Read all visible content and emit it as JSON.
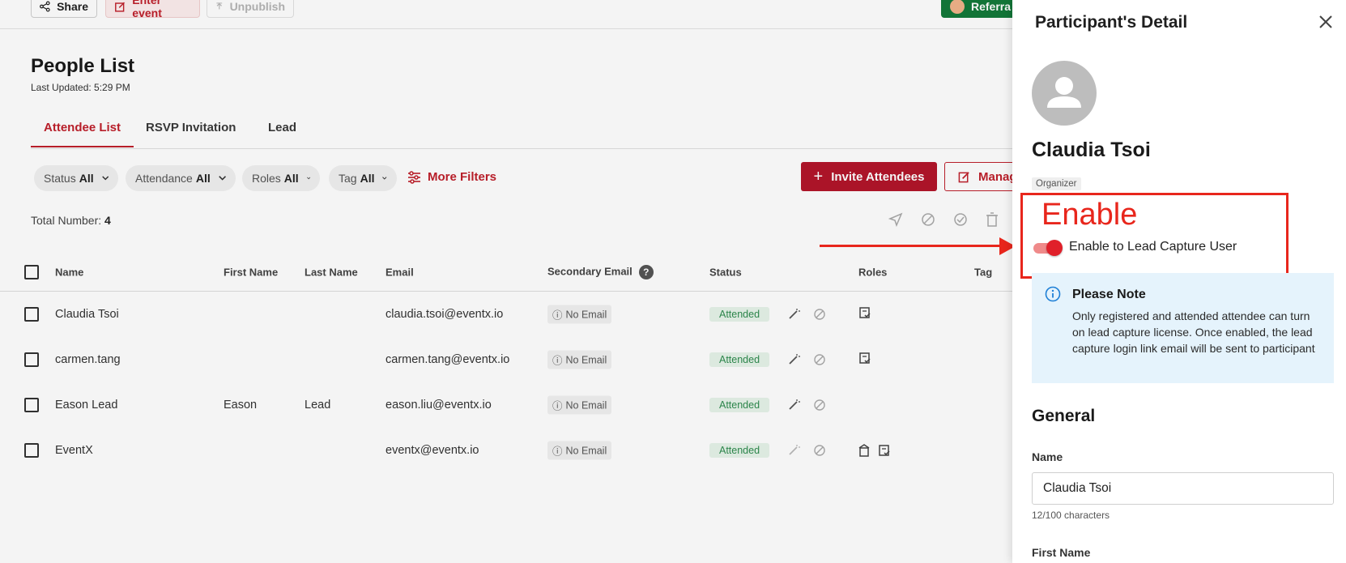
{
  "topbar": {
    "share_label": "Share",
    "enter_event_label": "Enter event",
    "unpublish_label": "Unpublish",
    "referral_label": "Referra"
  },
  "page": {
    "title": "People List",
    "last_updated": "Last Updated: 5:29 PM"
  },
  "tabs": [
    "Attendee List",
    "RSVP Invitation",
    "Lead"
  ],
  "filters": [
    {
      "label": "Status",
      "value": "All"
    },
    {
      "label": "Attendance",
      "value": "All"
    },
    {
      "label": "Roles",
      "value": "All"
    },
    {
      "label": "Tag",
      "value": "All"
    }
  ],
  "more_filters_label": "More Filters",
  "invite_label": "Invite Attendees",
  "manage_label": "Manag",
  "total": {
    "label": "Total Number:",
    "value": "4"
  },
  "table": {
    "headers": {
      "name": "Name",
      "first": "First Name",
      "last": "Last Name",
      "email": "Email",
      "secondary": "Secondary Email",
      "status": "Status",
      "roles": "Roles",
      "tag": "Tag"
    },
    "rows": [
      {
        "name": "Claudia Tsoi",
        "first": "",
        "last": "",
        "email": "claudia.tsoi@eventx.io",
        "secondary": "No Email",
        "status": "Attended"
      },
      {
        "name": "carmen.tang",
        "first": "",
        "last": "",
        "email": "carmen.tang@eventx.io",
        "secondary": "No Email",
        "status": "Attended"
      },
      {
        "name": "Eason Lead",
        "first": "Eason",
        "last": "Lead",
        "email": "eason.liu@eventx.io",
        "secondary": "No Email",
        "status": "Attended"
      },
      {
        "name": "EventX",
        "first": "",
        "last": "",
        "email": "eventx@eventx.io",
        "secondary": "No Email",
        "status": "Attended"
      }
    ]
  },
  "drawer": {
    "title": "Participant's Detail",
    "participant_name": "Claudia Tsoi",
    "role": "Organizer",
    "annotation_text": "Enable",
    "toggle_label": "Enable to Lead Capture User",
    "toggle_on": true,
    "note_title": "Please Note",
    "note_body": "Only registered and attended attendee can turn on lead capture license. Once enabled, the lead capture login link email will be sent to participant",
    "general_title": "General",
    "name_label": "Name",
    "name_value": "Claudia Tsoi",
    "char_count": "12/100 characters",
    "first_name_label": "First Name"
  },
  "colors": {
    "brand_red": "#c0202b",
    "annotation_red": "#e8261c",
    "attended_green": "#2e8b4e",
    "note_bg": "#e5f3fc"
  }
}
